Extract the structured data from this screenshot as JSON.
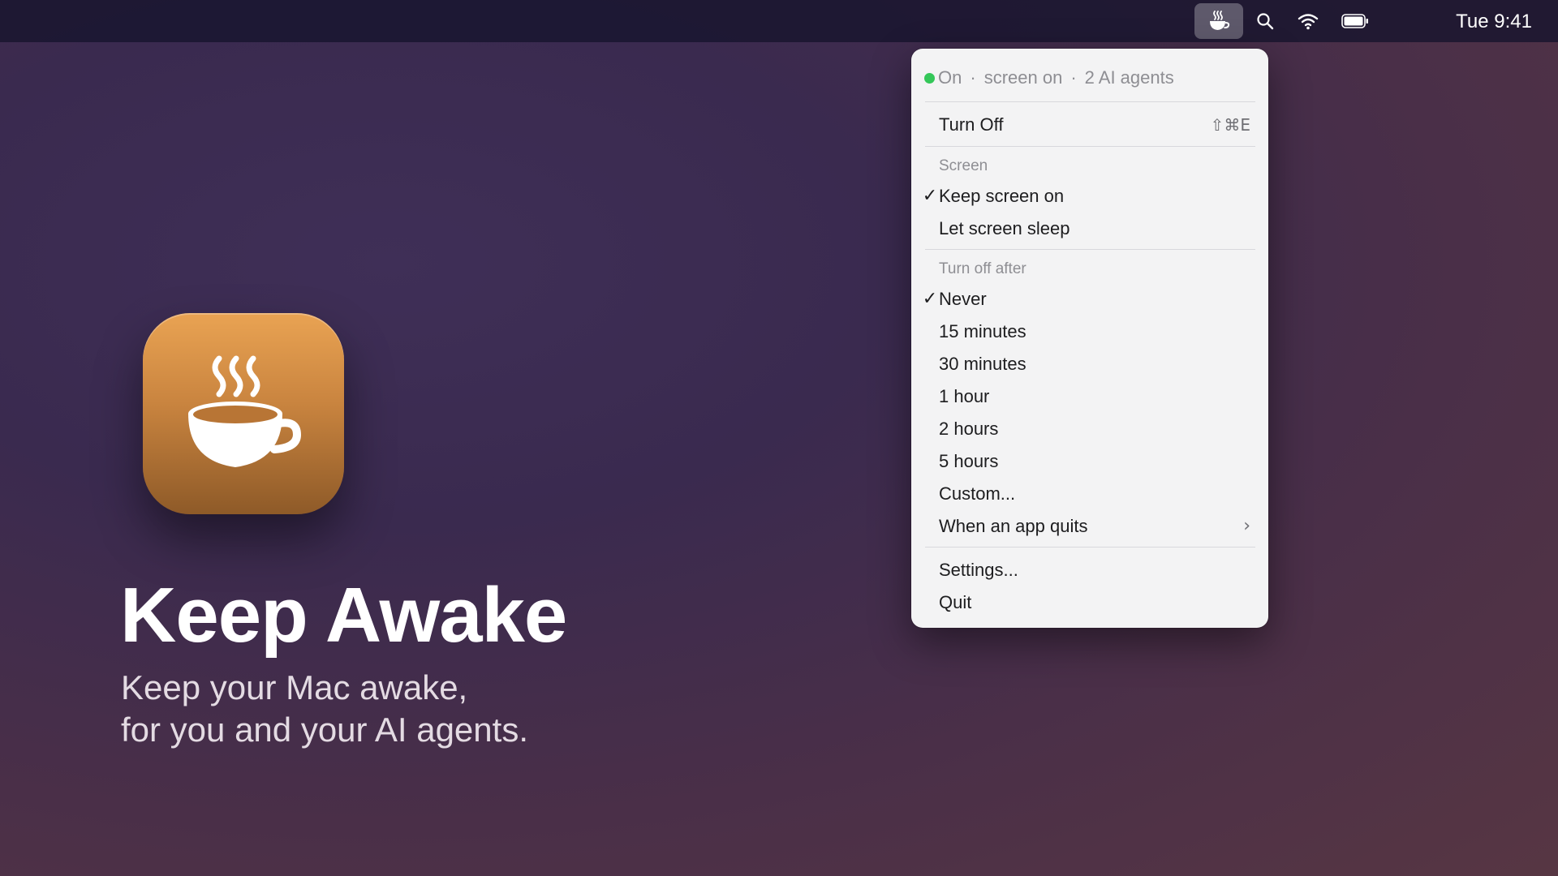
{
  "menubar": {
    "app_icon": "coffee-cup-icon",
    "search_icon": "search-icon",
    "wifi_icon": "wifi-icon",
    "battery_icon": "battery-icon",
    "clock": "Tue 9:41"
  },
  "hero": {
    "icon": "coffee-cup-icon",
    "title": "Keep Awake",
    "subtitle_line1": "Keep your Mac awake,",
    "subtitle_line2": "for you and your AI agents."
  },
  "menu": {
    "status": {
      "state": "On",
      "separator": "·",
      "screen": "screen on",
      "agents": "2 AI agents",
      "dot_color": "#34c759"
    },
    "turn_off": {
      "label": "Turn Off",
      "shortcut": "⇧⌘E"
    },
    "screen_section": {
      "header": "Screen",
      "items": [
        {
          "label": "Keep screen on",
          "checked": true
        },
        {
          "label": "Let screen sleep",
          "checked": false
        }
      ]
    },
    "turn_off_after": {
      "header": "Turn off after",
      "items": [
        {
          "label": "Never",
          "checked": true
        },
        {
          "label": "15 minutes",
          "checked": false
        },
        {
          "label": "30 minutes",
          "checked": false
        },
        {
          "label": "1 hour",
          "checked": false
        },
        {
          "label": "2 hours",
          "checked": false
        },
        {
          "label": "5 hours",
          "checked": false
        },
        {
          "label": "Custom...",
          "checked": false
        },
        {
          "label": "When an app quits",
          "checked": false,
          "submenu": "›"
        }
      ]
    },
    "check_mark": "✓",
    "settings": "Settings...",
    "quit": "Quit"
  },
  "colors": {
    "accent_green": "#34c759",
    "icon_orange": "#e9a353",
    "icon_brown": "#8e5a28",
    "menu_bg": "#f3f3f4"
  }
}
